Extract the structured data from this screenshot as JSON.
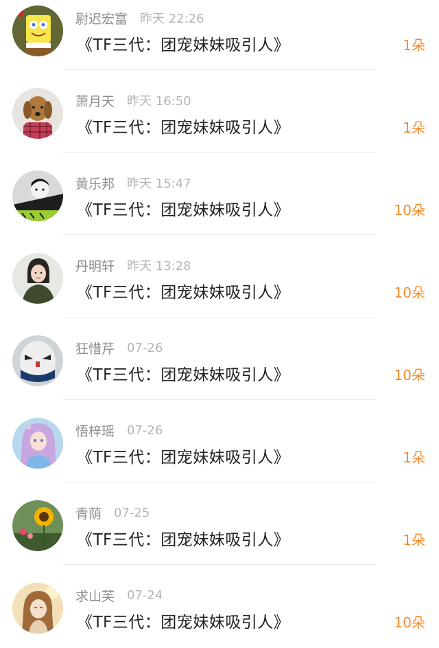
{
  "accent_color": "#f28a2c",
  "items": [
    {
      "username": "尉迟宏富",
      "time": "昨天 22:26",
      "title": "《TF三代：团宠妹妹吸引人》",
      "amount": "1朵",
      "avatar_icon": "spongebob-avatar-icon"
    },
    {
      "username": "萧月天",
      "time": "昨天 16:50",
      "title": "《TF三代：团宠妹妹吸引人》",
      "amount": "1朵",
      "avatar_icon": "dog-avatar-icon"
    },
    {
      "username": "黄乐邦",
      "time": "昨天 15:47",
      "title": "《TF三代：团宠妹妹吸引人》",
      "amount": "10朵",
      "avatar_icon": "bw-portrait-avatar-icon"
    },
    {
      "username": "丹明轩",
      "time": "昨天 13:28",
      "title": "《TF三代：团宠妹妹吸引人》",
      "amount": "10朵",
      "avatar_icon": "girl-portrait-avatar-icon"
    },
    {
      "username": "狂惜芹",
      "time": "07-26",
      "title": "《TF三代：团宠妹妹吸引人》",
      "amount": "10朵",
      "avatar_icon": "masked-face-avatar-icon"
    },
    {
      "username": "悟梓瑶",
      "time": "07-26",
      "title": "《TF三代：团宠妹妹吸引人》",
      "amount": "1朵",
      "avatar_icon": "anime-girl-avatar-icon"
    },
    {
      "username": "青荫",
      "time": "07-25",
      "title": "《TF三代：团宠妹妹吸引人》",
      "amount": "1朵",
      "avatar_icon": "sunflower-avatar-icon"
    },
    {
      "username": "求山芙",
      "time": "07-24",
      "title": "《TF三代：团宠妹妹吸引人》",
      "amount": "10朵",
      "avatar_icon": "illustrated-girl-avatar-icon"
    }
  ]
}
